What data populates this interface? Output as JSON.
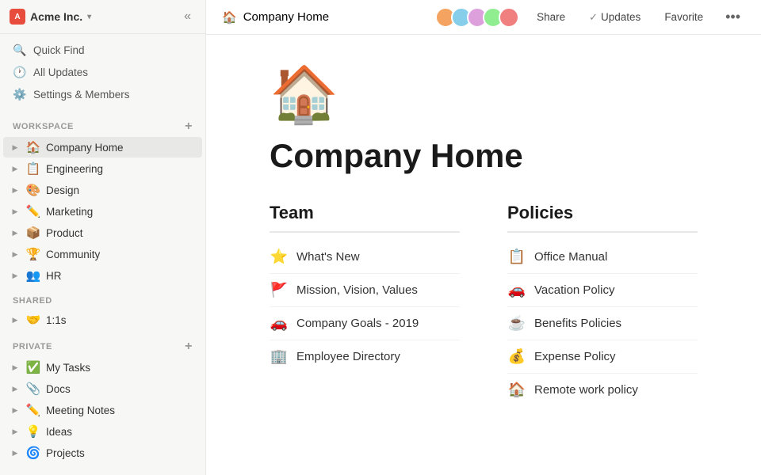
{
  "workspace": {
    "name": "Acme Inc.",
    "icon_text": "A",
    "icon_bg": "#e74c3c"
  },
  "sidebar": {
    "collapse_icon": "«",
    "nav_items": [
      {
        "id": "quick-find",
        "label": "Quick Find",
        "icon": "🔍"
      },
      {
        "id": "all-updates",
        "label": "All Updates",
        "icon": "🕐"
      },
      {
        "id": "settings-members",
        "label": "Settings & Members",
        "icon": "⚙️"
      }
    ],
    "workspace_section": "WORKSPACE",
    "workspace_items": [
      {
        "id": "company-home",
        "label": "Company Home",
        "emoji": "🏠",
        "active": true
      },
      {
        "id": "engineering",
        "label": "Engineering",
        "emoji": "📋"
      },
      {
        "id": "design",
        "label": "Design",
        "emoji": "🎨"
      },
      {
        "id": "marketing",
        "label": "Marketing",
        "emoji": "✏️"
      },
      {
        "id": "product",
        "label": "Product",
        "emoji": "📦"
      },
      {
        "id": "community",
        "label": "Community",
        "emoji": "🏆"
      },
      {
        "id": "hr",
        "label": "HR",
        "emoji": "👥"
      }
    ],
    "shared_section": "SHARED",
    "shared_items": [
      {
        "id": "1-1s",
        "label": "1:1s",
        "emoji": "🤝"
      }
    ],
    "private_section": "PRIVATE",
    "private_items": [
      {
        "id": "my-tasks",
        "label": "My Tasks",
        "emoji": "✅"
      },
      {
        "id": "docs",
        "label": "Docs",
        "emoji": "📎"
      },
      {
        "id": "meeting-notes",
        "label": "Meeting Notes",
        "emoji": "✏️"
      },
      {
        "id": "ideas",
        "label": "Ideas",
        "emoji": "💡"
      },
      {
        "id": "projects",
        "label": "Projects",
        "emoji": "🌀"
      }
    ]
  },
  "topbar": {
    "page_icon": "🏠",
    "page_title": "Company Home",
    "share_label": "Share",
    "updates_label": "Updates",
    "favorite_label": "Favorite",
    "more_icon": "•••"
  },
  "page": {
    "icon": "🏠",
    "title": "Company Home",
    "team_section": {
      "header": "Team",
      "items": [
        {
          "id": "whats-new",
          "icon": "⭐",
          "text": "What's New"
        },
        {
          "id": "mission-vision-values",
          "icon": "🚩",
          "text": "Mission, Vision, Values"
        },
        {
          "id": "company-goals-2019",
          "icon": "🚗",
          "text": "Company Goals - 2019"
        },
        {
          "id": "employee-directory",
          "icon": "🏢",
          "text": "Employee Directory"
        }
      ]
    },
    "policies_section": {
      "header": "Policies",
      "items": [
        {
          "id": "office-manual",
          "icon": "📋",
          "text": "Office Manual"
        },
        {
          "id": "vacation-policy",
          "icon": "🚗",
          "text": "Vacation Policy"
        },
        {
          "id": "benefits-policies",
          "icon": "☕",
          "text": "Benefits Policies"
        },
        {
          "id": "expense-policy",
          "icon": "💰",
          "text": "Expense Policy"
        },
        {
          "id": "remote-work-policy",
          "icon": "🏠",
          "text": "Remote work policy"
        }
      ]
    }
  }
}
